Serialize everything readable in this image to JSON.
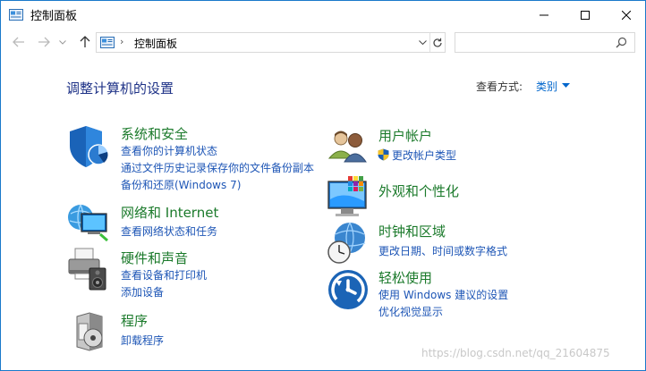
{
  "window": {
    "title": "控制面板"
  },
  "address": {
    "path": "控制面板",
    "search_placeholder": ""
  },
  "main": {
    "heading": "调整计算机的设置",
    "view_by_label": "查看方式:",
    "view_by_value": "类别"
  },
  "categories": [
    {
      "title": "系统和安全",
      "links": [
        "查看你的计算机状态",
        "通过文件历史记录保存你的文件备份副本",
        "备份和还原(Windows 7)"
      ]
    },
    {
      "title": "网络和 Internet",
      "links": [
        "查看网络状态和任务"
      ]
    },
    {
      "title": "硬件和声音",
      "links": [
        "查看设备和打印机",
        "添加设备"
      ]
    },
    {
      "title": "程序",
      "links": [
        "卸载程序"
      ]
    },
    {
      "title": "用户帐户",
      "links": [
        "更改帐户类型"
      ]
    },
    {
      "title": "外观和个性化",
      "links": []
    },
    {
      "title": "时钟和区域",
      "links": [
        "更改日期、时间或数字格式"
      ]
    },
    {
      "title": "轻松使用",
      "links": [
        "使用 Windows 建议的设置",
        "优化视觉显示"
      ]
    }
  ],
  "watermark": "https://blog.csdn.net/qq_21604875",
  "colors": {
    "accent": "#1979ca",
    "link": "#1e56b6",
    "category_title": "#1b7a2b",
    "heading": "#1e3287"
  }
}
